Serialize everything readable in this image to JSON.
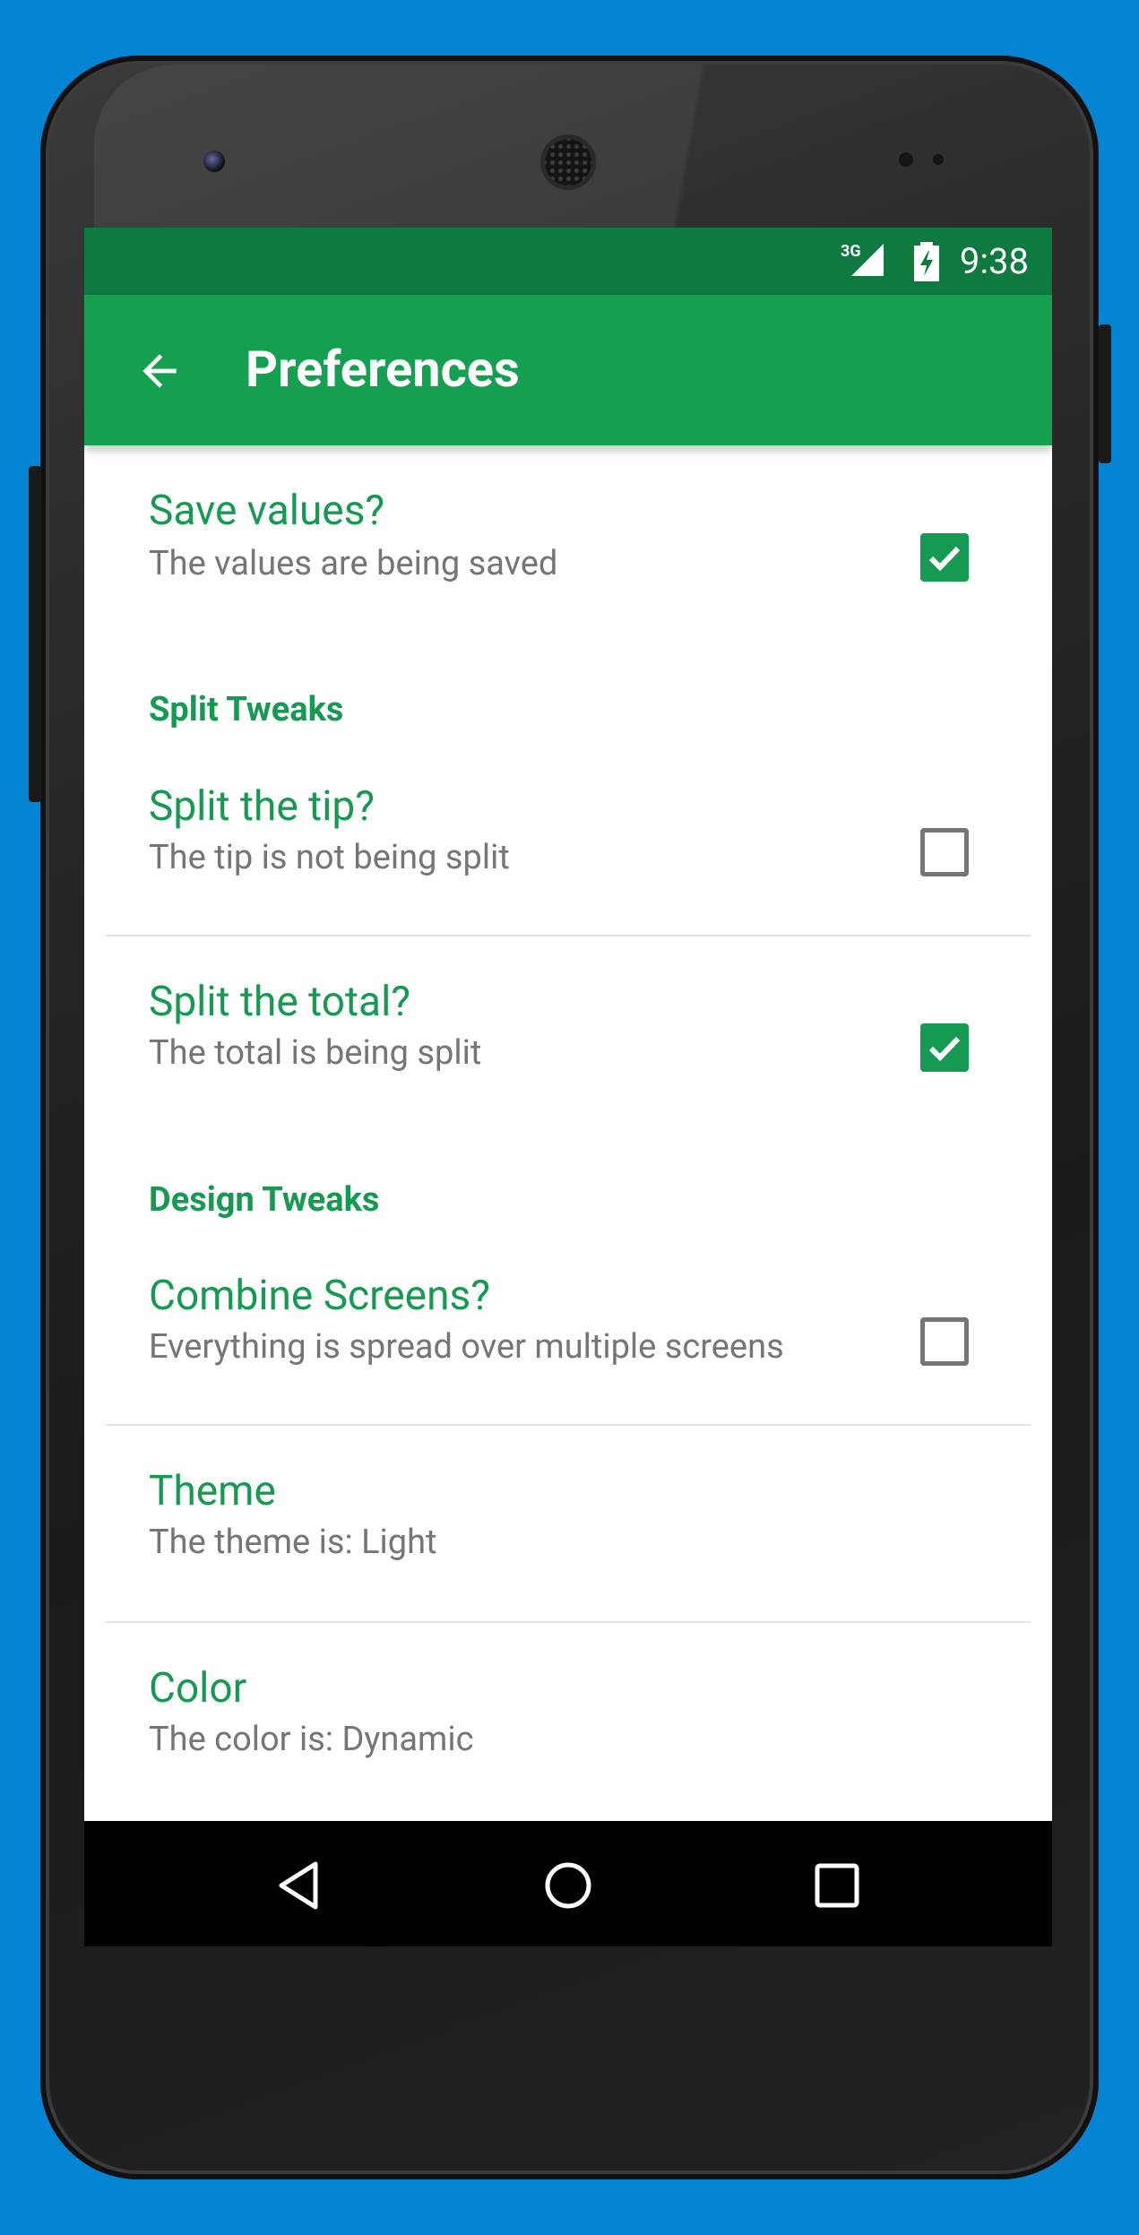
{
  "status_bar": {
    "network_type": "3G",
    "signal_icon": "cell-signal-icon",
    "battery_icon": "battery-charging-icon",
    "time": "9:38"
  },
  "app_bar": {
    "back_icon": "arrow-back-icon",
    "title": "Preferences"
  },
  "colors": {
    "primary": "#14a050",
    "primary_dark": "#0f7a40",
    "accent_text": "#169a52",
    "summary_text": "#757575",
    "background": "#0684d4"
  },
  "preferences": {
    "save_values": {
      "title": "Save values?",
      "summary": "The values are being saved",
      "checked": true
    },
    "split_category": "Split Tweaks",
    "split_tip": {
      "title": "Split the tip?",
      "summary": "The tip is not being split",
      "checked": false
    },
    "split_total": {
      "title": "Split the total?",
      "summary": "The total is being split",
      "checked": true
    },
    "design_category": "Design Tweaks",
    "combine_screens": {
      "title": "Combine Screens?",
      "summary": "Everything is spread over multiple screens",
      "checked": false
    },
    "theme": {
      "title": "Theme",
      "summary": "The theme is: Light"
    },
    "color": {
      "title": "Color",
      "summary": "The color is: Dynamic"
    }
  },
  "nav_bar": {
    "back": "nav-back-icon",
    "home": "nav-home-icon",
    "recents": "nav-recents-icon"
  }
}
